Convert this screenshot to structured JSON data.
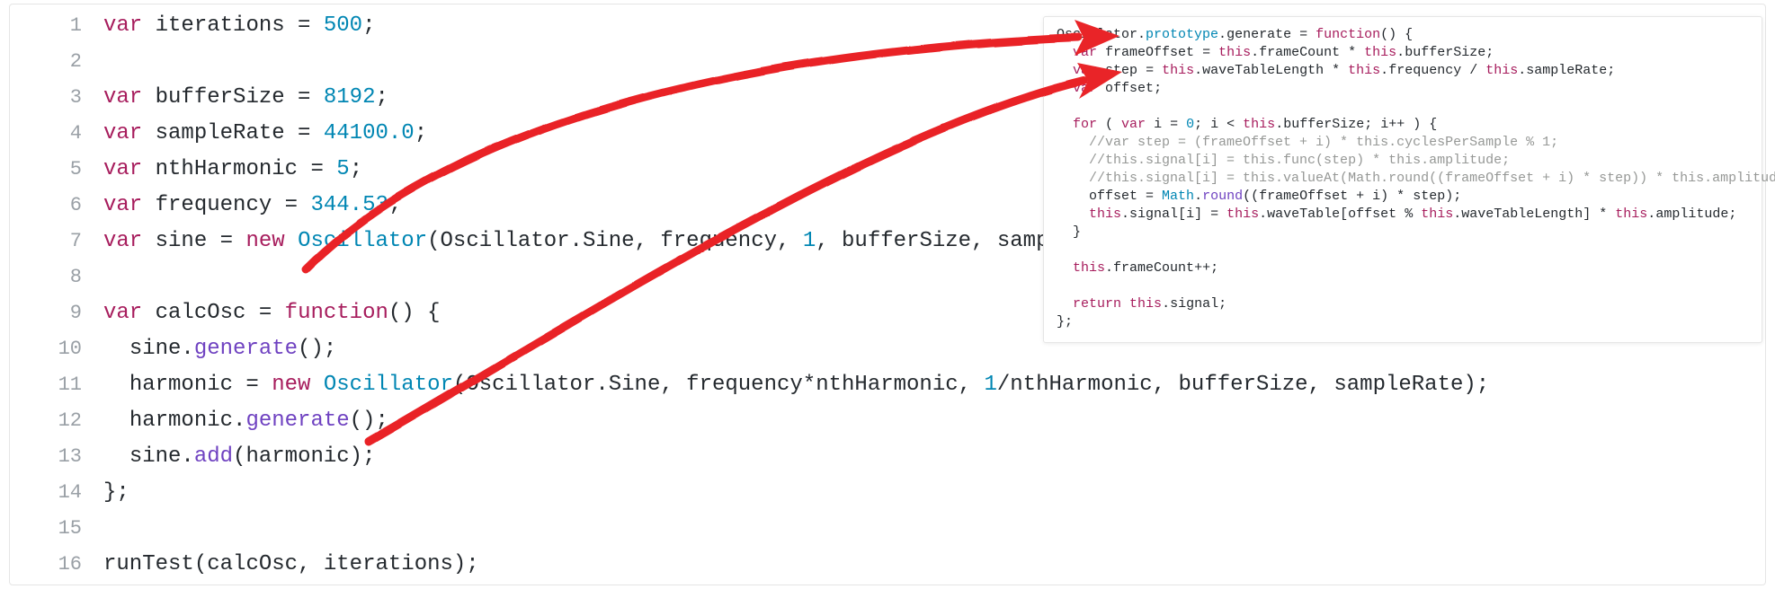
{
  "editor": {
    "lines": [
      {
        "n": 1,
        "indent": 0,
        "tokens": [
          [
            "kw",
            "var"
          ],
          [
            "punc",
            " "
          ],
          [
            "prop",
            "iterations"
          ],
          [
            "punc",
            " = "
          ],
          [
            "num",
            "500"
          ],
          [
            "punc",
            ";"
          ]
        ]
      },
      {
        "n": 2,
        "indent": 0,
        "tokens": []
      },
      {
        "n": 3,
        "indent": 0,
        "tokens": [
          [
            "kw",
            "var"
          ],
          [
            "punc",
            " "
          ],
          [
            "prop",
            "bufferSize"
          ],
          [
            "punc",
            " = "
          ],
          [
            "num",
            "8192"
          ],
          [
            "punc",
            ";"
          ]
        ]
      },
      {
        "n": 4,
        "indent": 0,
        "tokens": [
          [
            "kw",
            "var"
          ],
          [
            "punc",
            " "
          ],
          [
            "prop",
            "sampleRate"
          ],
          [
            "punc",
            " = "
          ],
          [
            "num",
            "44100.0"
          ],
          [
            "punc",
            ";"
          ]
        ]
      },
      {
        "n": 5,
        "indent": 0,
        "tokens": [
          [
            "kw",
            "var"
          ],
          [
            "punc",
            " "
          ],
          [
            "prop",
            "nthHarmonic"
          ],
          [
            "punc",
            " = "
          ],
          [
            "num",
            "5"
          ],
          [
            "punc",
            ";"
          ]
        ]
      },
      {
        "n": 6,
        "indent": 0,
        "tokens": [
          [
            "kw",
            "var"
          ],
          [
            "punc",
            " "
          ],
          [
            "prop",
            "frequency"
          ],
          [
            "punc",
            " = "
          ],
          [
            "num",
            "344.53"
          ],
          [
            "punc",
            ";"
          ]
        ]
      },
      {
        "n": 7,
        "indent": 0,
        "tokens": [
          [
            "kw",
            "var"
          ],
          [
            "punc",
            " "
          ],
          [
            "prop",
            "sine"
          ],
          [
            "punc",
            " = "
          ],
          [
            "kw",
            "new"
          ],
          [
            "punc",
            " "
          ],
          [
            "type",
            "Oscillator"
          ],
          [
            "punc",
            "("
          ],
          [
            "prop",
            "Oscillator"
          ],
          [
            "punc",
            "."
          ],
          [
            "prop",
            "Sine"
          ],
          [
            "punc",
            ", "
          ],
          [
            "prop",
            "frequency"
          ],
          [
            "punc",
            ", "
          ],
          [
            "num",
            "1"
          ],
          [
            "punc",
            ", "
          ],
          [
            "prop",
            "bufferSize"
          ],
          [
            "punc",
            ", "
          ],
          [
            "prop",
            "sampleRate"
          ],
          [
            "punc",
            ");"
          ]
        ]
      },
      {
        "n": 8,
        "indent": 0,
        "tokens": []
      },
      {
        "n": 9,
        "indent": 0,
        "tokens": [
          [
            "kw",
            "var"
          ],
          [
            "punc",
            " "
          ],
          [
            "prop",
            "calcOsc"
          ],
          [
            "punc",
            " = "
          ],
          [
            "kw",
            "function"
          ],
          [
            "punc",
            "() {"
          ]
        ]
      },
      {
        "n": 10,
        "indent": 1,
        "tokens": [
          [
            "prop",
            "sine"
          ],
          [
            "punc",
            "."
          ],
          [
            "call",
            "generate"
          ],
          [
            "punc",
            "();"
          ]
        ]
      },
      {
        "n": 11,
        "indent": 1,
        "tokens": [
          [
            "prop",
            "harmonic"
          ],
          [
            "punc",
            " = "
          ],
          [
            "kw",
            "new"
          ],
          [
            "punc",
            " "
          ],
          [
            "type",
            "Oscillator"
          ],
          [
            "punc",
            "("
          ],
          [
            "prop",
            "Oscillator"
          ],
          [
            "punc",
            "."
          ],
          [
            "prop",
            "Sine"
          ],
          [
            "punc",
            ", "
          ],
          [
            "prop",
            "frequency"
          ],
          [
            "punc",
            "*"
          ],
          [
            "prop",
            "nthHarmonic"
          ],
          [
            "punc",
            ", "
          ],
          [
            "num",
            "1"
          ],
          [
            "punc",
            "/"
          ],
          [
            "prop",
            "nthHarmonic"
          ],
          [
            "punc",
            ", "
          ],
          [
            "prop",
            "bufferSize"
          ],
          [
            "punc",
            ", "
          ],
          [
            "prop",
            "sampleRate"
          ],
          [
            "punc",
            ");"
          ]
        ]
      },
      {
        "n": 12,
        "indent": 1,
        "tokens": [
          [
            "prop",
            "harmonic"
          ],
          [
            "punc",
            "."
          ],
          [
            "call",
            "generate"
          ],
          [
            "punc",
            "();"
          ]
        ]
      },
      {
        "n": 13,
        "indent": 1,
        "tokens": [
          [
            "prop",
            "sine"
          ],
          [
            "punc",
            "."
          ],
          [
            "call",
            "add"
          ],
          [
            "punc",
            "("
          ],
          [
            "prop",
            "harmonic"
          ],
          [
            "punc",
            ");"
          ]
        ]
      },
      {
        "n": 14,
        "indent": 0,
        "tokens": [
          [
            "punc",
            "};"
          ]
        ]
      },
      {
        "n": 15,
        "indent": 0,
        "tokens": []
      },
      {
        "n": 16,
        "indent": 0,
        "tokens": [
          [
            "prop",
            "runTest"
          ],
          [
            "punc",
            "("
          ],
          [
            "prop",
            "calcOsc"
          ],
          [
            "punc",
            ", "
          ],
          [
            "prop",
            "iterations"
          ],
          [
            "punc",
            ");"
          ]
        ]
      }
    ]
  },
  "inset_lines": [
    {
      "indent": 0,
      "tokens": [
        [
          "prop",
          "Oscillator"
        ],
        [
          "punc",
          "."
        ],
        [
          "teal",
          "prototype"
        ],
        [
          "punc",
          "."
        ],
        [
          "prop",
          "generate"
        ],
        [
          "punc",
          " = "
        ],
        [
          "kw",
          "function"
        ],
        [
          "punc",
          "() {"
        ]
      ]
    },
    {
      "indent": 1,
      "tokens": [
        [
          "kw",
          "var"
        ],
        [
          "punc",
          " "
        ],
        [
          "prop",
          "frameOffset"
        ],
        [
          "punc",
          " = "
        ],
        [
          "this",
          "this"
        ],
        [
          "punc",
          "."
        ],
        [
          "prop",
          "frameCount"
        ],
        [
          "punc",
          " * "
        ],
        [
          "this",
          "this"
        ],
        [
          "punc",
          "."
        ],
        [
          "prop",
          "bufferSize"
        ],
        [
          "punc",
          ";"
        ]
      ]
    },
    {
      "indent": 1,
      "tokens": [
        [
          "kw",
          "var"
        ],
        [
          "punc",
          " "
        ],
        [
          "prop",
          "step"
        ],
        [
          "punc",
          " = "
        ],
        [
          "this",
          "this"
        ],
        [
          "punc",
          "."
        ],
        [
          "prop",
          "waveTableLength"
        ],
        [
          "punc",
          " * "
        ],
        [
          "this",
          "this"
        ],
        [
          "punc",
          "."
        ],
        [
          "prop",
          "frequency"
        ],
        [
          "punc",
          " / "
        ],
        [
          "this",
          "this"
        ],
        [
          "punc",
          "."
        ],
        [
          "prop",
          "sampleRate"
        ],
        [
          "punc",
          ";"
        ]
      ]
    },
    {
      "indent": 1,
      "tokens": [
        [
          "kw",
          "var"
        ],
        [
          "punc",
          " "
        ],
        [
          "prop",
          "offset"
        ],
        [
          "punc",
          ";"
        ]
      ]
    },
    {
      "indent": 0,
      "tokens": []
    },
    {
      "indent": 1,
      "tokens": [
        [
          "kw",
          "for"
        ],
        [
          "punc",
          " ( "
        ],
        [
          "kw",
          "var"
        ],
        [
          "punc",
          " "
        ],
        [
          "prop",
          "i"
        ],
        [
          "punc",
          " = "
        ],
        [
          "num",
          "0"
        ],
        [
          "punc",
          "; "
        ],
        [
          "prop",
          "i"
        ],
        [
          "punc",
          " < "
        ],
        [
          "this",
          "this"
        ],
        [
          "punc",
          "."
        ],
        [
          "prop",
          "bufferSize"
        ],
        [
          "punc",
          "; "
        ],
        [
          "prop",
          "i"
        ],
        [
          "punc",
          "++ ) {"
        ]
      ]
    },
    {
      "indent": 2,
      "tokens": [
        [
          "cmnt",
          "//var step = (frameOffset + i) * this.cyclesPerSample % 1;"
        ]
      ]
    },
    {
      "indent": 2,
      "tokens": [
        [
          "cmnt",
          "//this.signal[i] = this.func(step) * this.amplitude;"
        ]
      ]
    },
    {
      "indent": 2,
      "tokens": [
        [
          "cmnt",
          "//this.signal[i] = this.valueAt(Math.round((frameOffset + i) * step)) * this.amplitude;"
        ]
      ]
    },
    {
      "indent": 2,
      "tokens": [
        [
          "prop",
          "offset"
        ],
        [
          "punc",
          " = "
        ],
        [
          "type",
          "Math"
        ],
        [
          "punc",
          "."
        ],
        [
          "call",
          "round"
        ],
        [
          "punc",
          "(("
        ],
        [
          "prop",
          "frameOffset"
        ],
        [
          "punc",
          " + "
        ],
        [
          "prop",
          "i"
        ],
        [
          "punc",
          ") * "
        ],
        [
          "prop",
          "step"
        ],
        [
          "punc",
          ");"
        ]
      ]
    },
    {
      "indent": 2,
      "tokens": [
        [
          "this",
          "this"
        ],
        [
          "punc",
          "."
        ],
        [
          "prop",
          "signal"
        ],
        [
          "punc",
          "["
        ],
        [
          "prop",
          "i"
        ],
        [
          "punc",
          "] = "
        ],
        [
          "this",
          "this"
        ],
        [
          "punc",
          "."
        ],
        [
          "prop",
          "waveTable"
        ],
        [
          "punc",
          "["
        ],
        [
          "prop",
          "offset"
        ],
        [
          "punc",
          " % "
        ],
        [
          "this",
          "this"
        ],
        [
          "punc",
          "."
        ],
        [
          "prop",
          "waveTableLength"
        ],
        [
          "punc",
          "] * "
        ],
        [
          "this",
          "this"
        ],
        [
          "punc",
          "."
        ],
        [
          "prop",
          "amplitude"
        ],
        [
          "punc",
          ";"
        ]
      ]
    },
    {
      "indent": 1,
      "tokens": [
        [
          "punc",
          "}"
        ]
      ]
    },
    {
      "indent": 0,
      "tokens": []
    },
    {
      "indent": 1,
      "tokens": [
        [
          "this",
          "this"
        ],
        [
          "punc",
          "."
        ],
        [
          "prop",
          "frameCount"
        ],
        [
          "punc",
          "++;"
        ]
      ]
    },
    {
      "indent": 0,
      "tokens": []
    },
    {
      "indent": 1,
      "tokens": [
        [
          "kw",
          "return"
        ],
        [
          "punc",
          " "
        ],
        [
          "this",
          "this"
        ],
        [
          "punc",
          "."
        ],
        [
          "prop",
          "signal"
        ],
        [
          "punc",
          ";"
        ]
      ]
    },
    {
      "indent": 0,
      "tokens": [
        [
          "punc",
          "};"
        ]
      ]
    }
  ],
  "annotation_color": "#e92428"
}
